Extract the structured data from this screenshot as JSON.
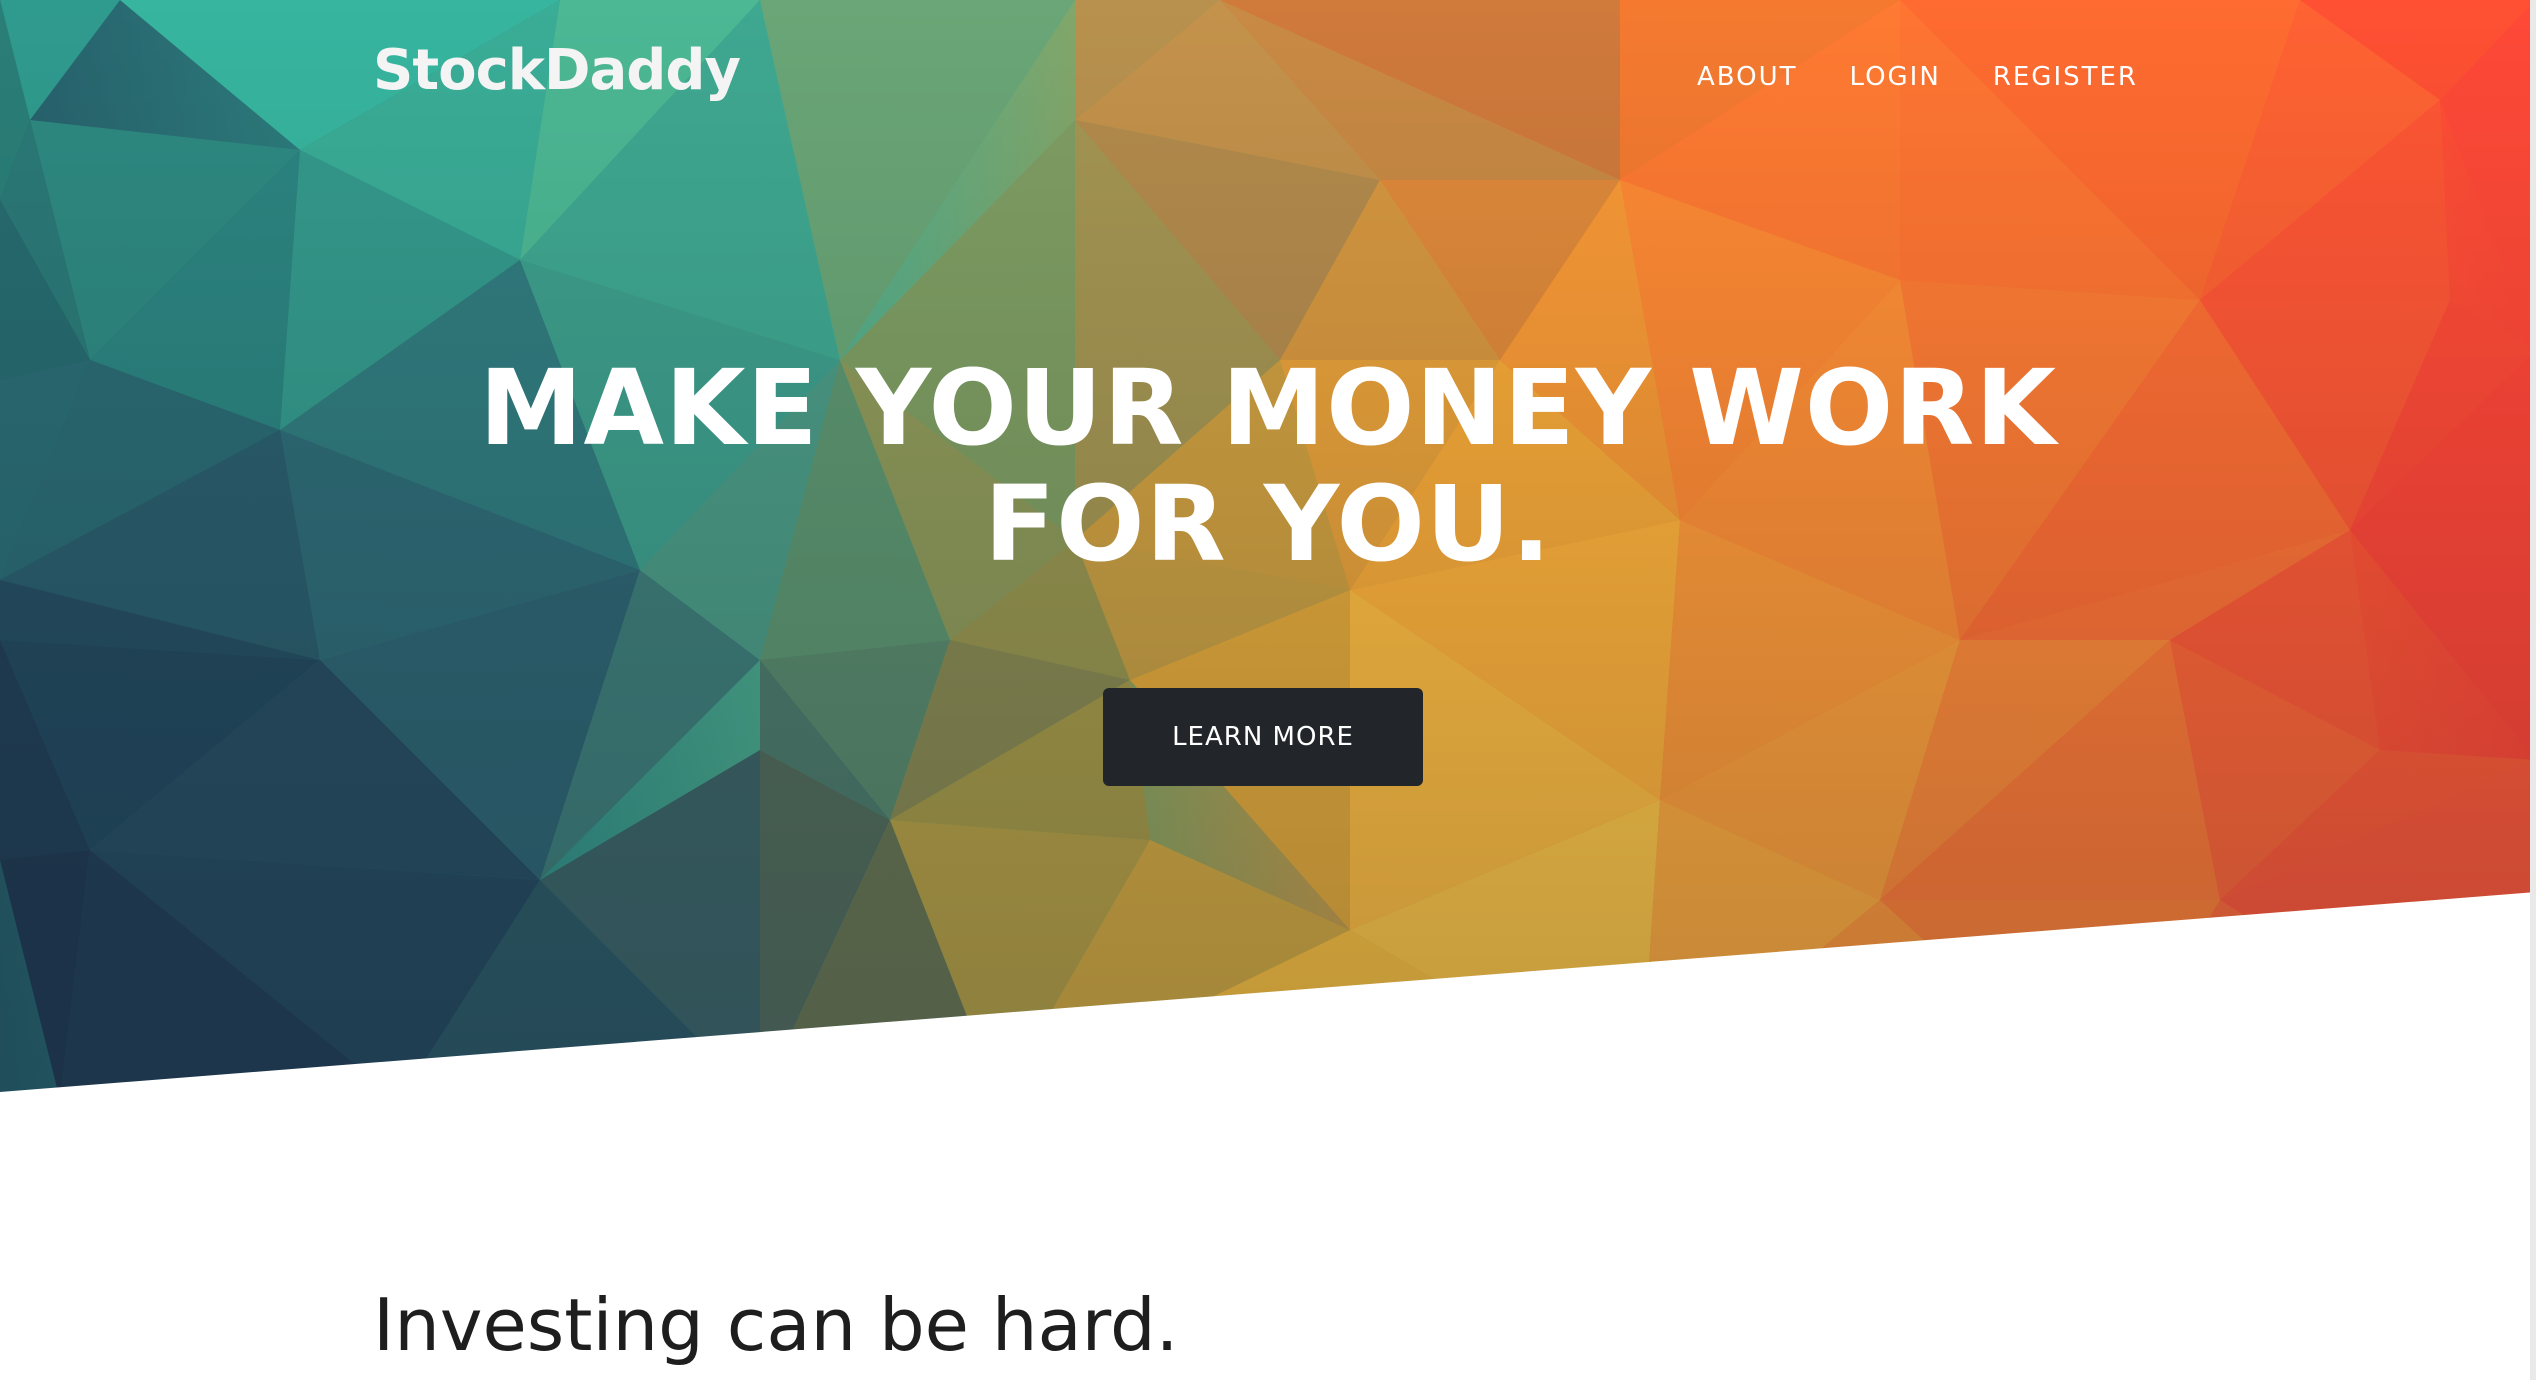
{
  "brand": {
    "name": "StockDaddy"
  },
  "nav": {
    "items": [
      {
        "label": "ABOUT"
      },
      {
        "label": "LOGIN"
      },
      {
        "label": "REGISTER"
      }
    ]
  },
  "hero": {
    "title_line1": "MAKE YOUR MONEY WORK",
    "title_line2": "FOR YOU.",
    "cta_label": "LEARN MORE"
  },
  "section": {
    "heading": "Investing can be hard."
  },
  "colors": {
    "teal": "#35b5a0",
    "navy": "#1f3a4a",
    "orange": "#ff7a2e",
    "red": "#ff4a3a",
    "button_bg": "#22262b"
  }
}
